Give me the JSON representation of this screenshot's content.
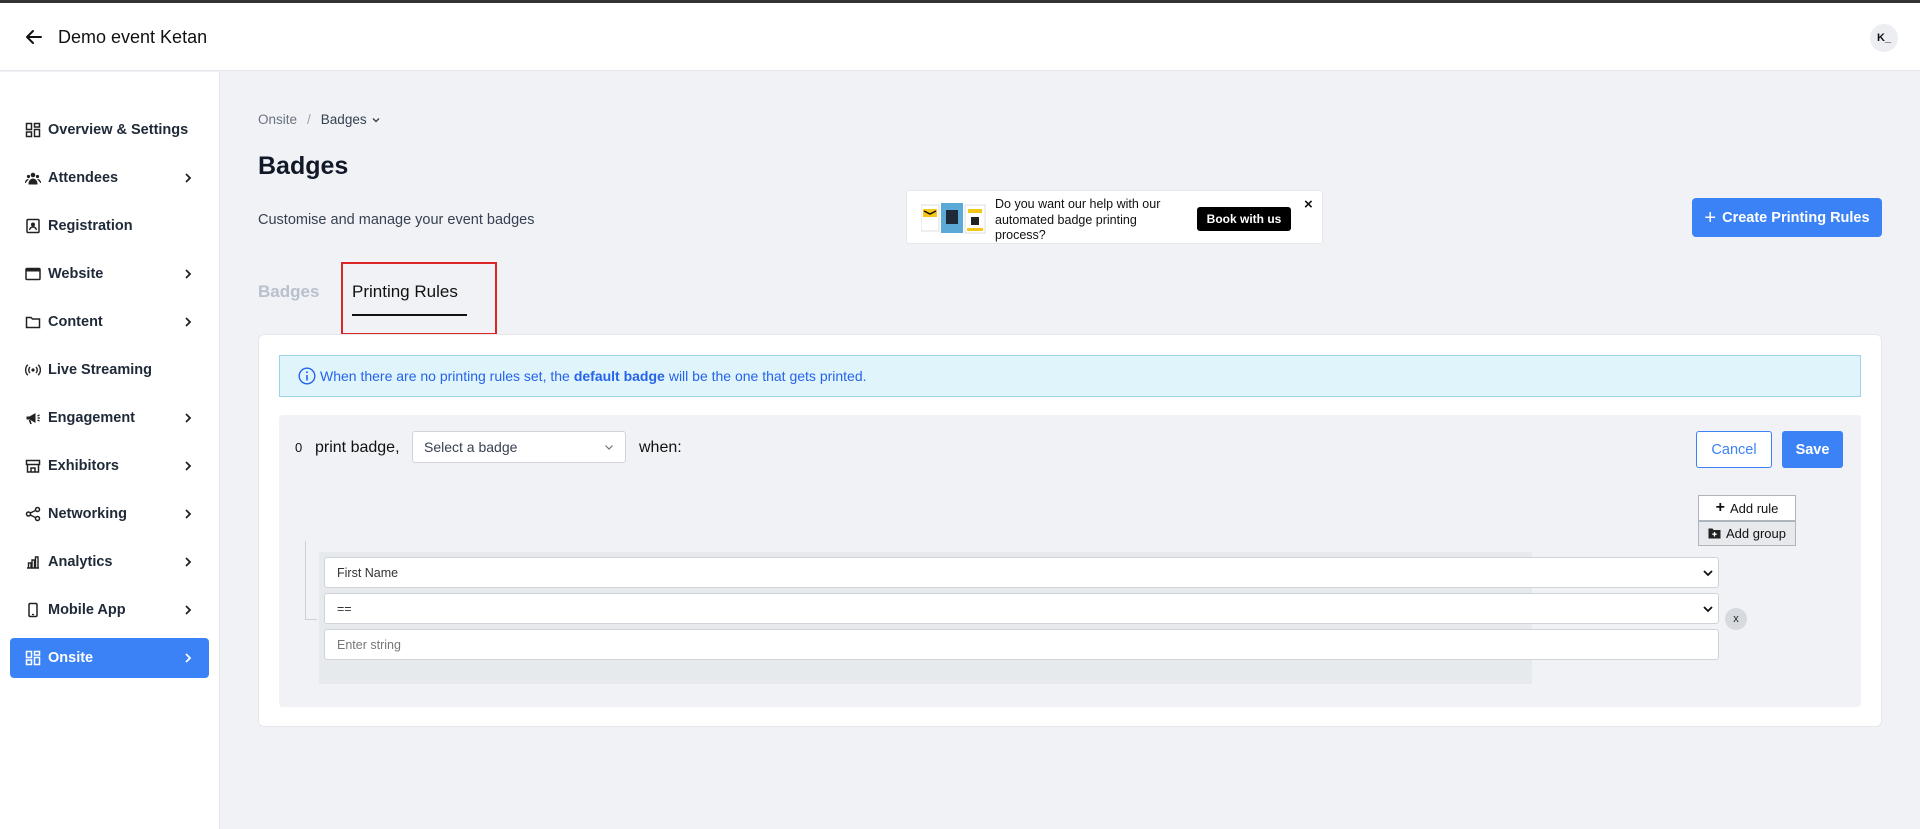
{
  "header": {
    "event_title": "Demo event Ketan",
    "avatar_initials": "K_"
  },
  "sidebar": {
    "items": [
      {
        "label": "Overview & Settings",
        "icon": "dashboard-icon",
        "has_children": false,
        "active": false
      },
      {
        "label": "Attendees",
        "icon": "people-icon",
        "has_children": true,
        "active": false
      },
      {
        "label": "Registration",
        "icon": "id-card-icon",
        "has_children": false,
        "active": false
      },
      {
        "label": "Website",
        "icon": "browser-icon",
        "has_children": true,
        "active": false
      },
      {
        "label": "Content",
        "icon": "folder-icon",
        "has_children": true,
        "active": false
      },
      {
        "label": "Live Streaming",
        "icon": "broadcast-icon",
        "has_children": false,
        "active": false
      },
      {
        "label": "Engagement",
        "icon": "megaphone-icon",
        "has_children": true,
        "active": false
      },
      {
        "label": "Exhibitors",
        "icon": "store-icon",
        "has_children": true,
        "active": false
      },
      {
        "label": "Networking",
        "icon": "share-nodes-icon",
        "has_children": true,
        "active": false
      },
      {
        "label": "Analytics",
        "icon": "bar-chart-icon",
        "has_children": true,
        "active": false
      },
      {
        "label": "Mobile App",
        "icon": "phone-icon",
        "has_children": true,
        "active": false
      },
      {
        "label": "Onsite",
        "icon": "dashboard-icon",
        "has_children": true,
        "active": true
      }
    ],
    "active_color": "#3b82f6"
  },
  "breadcrumb": {
    "parent": "Onsite",
    "separator": "/",
    "current": "Badges"
  },
  "page": {
    "title": "Badges",
    "subtitle": "Customise and manage your event badges"
  },
  "promo": {
    "text": "Do you want our help with our automated badge printing process?",
    "button_label": "Book with us",
    "close_label": "×"
  },
  "create_button_label": "Create Printing Rules",
  "tabs": [
    {
      "label": "Badges",
      "active": false
    },
    {
      "label": "Printing Rules",
      "active": true
    }
  ],
  "info_banner": {
    "before": "When there are no printing rules set, the",
    "bold": "default badge",
    "after": "will be the one that gets printed."
  },
  "rule": {
    "index": "0",
    "print_label": "print badge,",
    "badge_select_value": "Select a badge",
    "when_label": "when:",
    "cancel_label": "Cancel",
    "save_label": "Save",
    "add_rule_label": "Add rule",
    "add_group_label": "Add group",
    "field_value": "First Name",
    "operator_value": "==",
    "value_placeholder": "Enter string",
    "remove_label": "x"
  },
  "colors": {
    "primary": "#3b82f6",
    "info_bg": "#e0f4fb",
    "highlight": "#dc2626"
  }
}
